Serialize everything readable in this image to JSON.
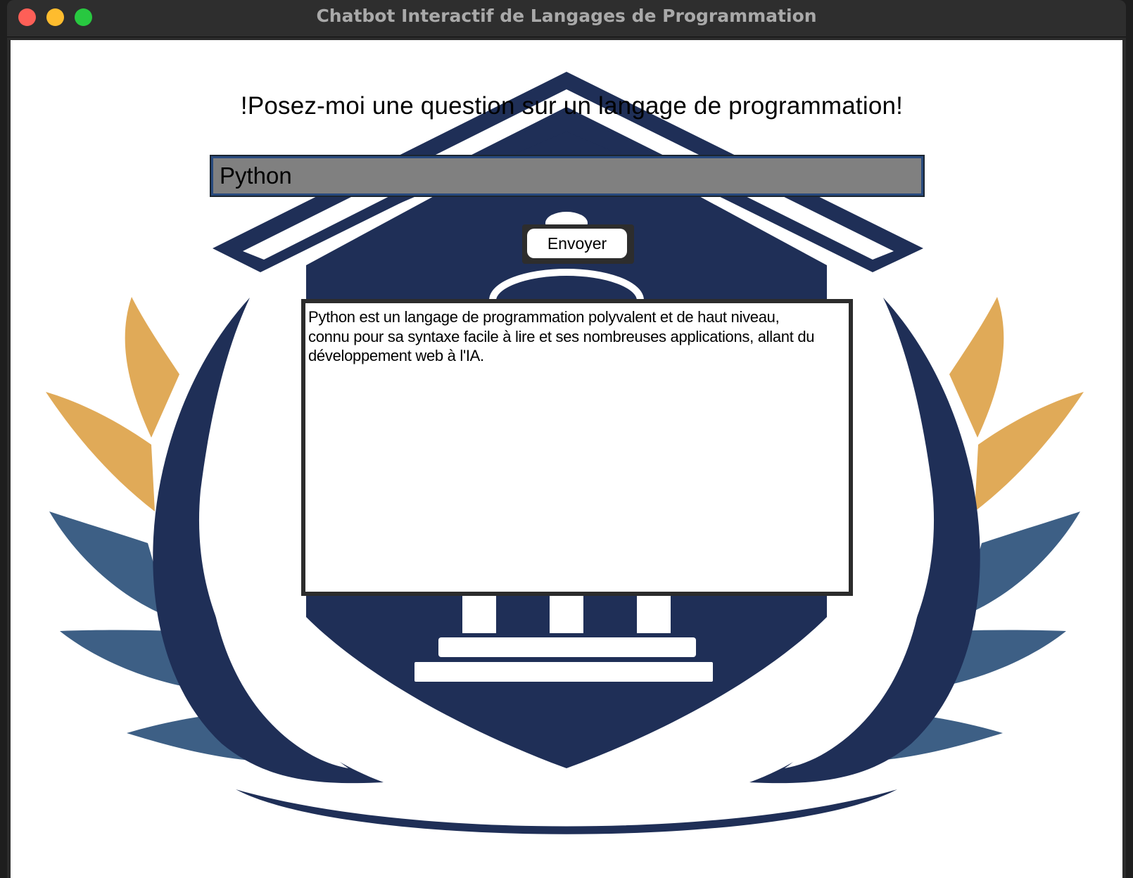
{
  "window": {
    "title": "Chatbot Interactif de Langages de Programmation"
  },
  "main": {
    "prompt": "!Posez-moi une question sur un langage de programmation!",
    "input_value": "Python",
    "send_label": "Envoyer",
    "response": "Python est un langage de programmation polyvalent et de haut niveau,\nconnu pour sa syntaxe facile à lire et ses nombreuses applications, allant du\ndéveloppement web à l'IA."
  },
  "colors": {
    "navy": "#1f2f57",
    "steel_blue": "#3d5f85",
    "gold": "#e0aa58",
    "entry_bg": "#808080"
  },
  "icons": [
    "close-window-icon",
    "minimize-window-icon",
    "maximize-window-icon",
    "academy-emblem-logo"
  ]
}
